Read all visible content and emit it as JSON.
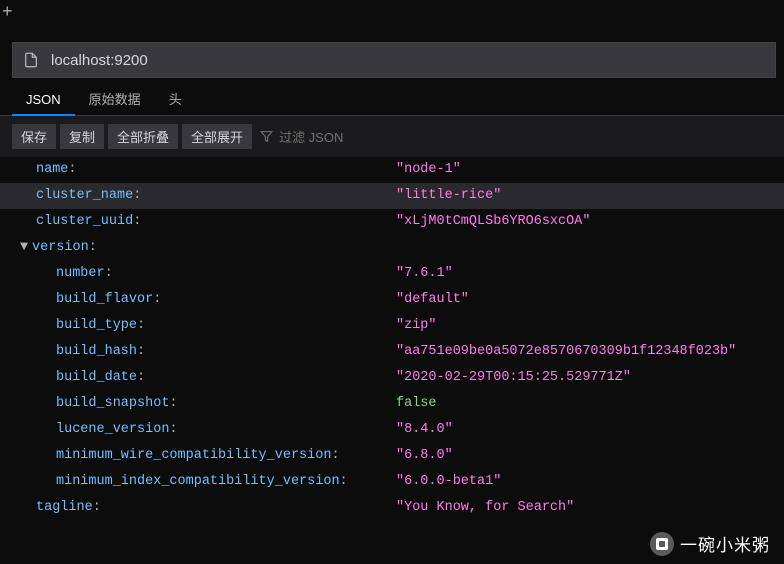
{
  "window": {
    "new_tab_icon": "+"
  },
  "address_bar": {
    "url": "localhost:9200"
  },
  "tabs": {
    "json": "JSON",
    "raw": "原始数据",
    "headers": "头"
  },
  "toolbar": {
    "save": "保存",
    "copy": "复制",
    "collapse_all": "全部折叠",
    "expand_all": "全部展开",
    "filter_placeholder": "过滤 JSON"
  },
  "json": {
    "name_key": "name",
    "name_val": "\"node-1\"",
    "cluster_name_key": "cluster_name",
    "cluster_name_val": "\"little-rice\"",
    "cluster_uuid_key": "cluster_uuid",
    "cluster_uuid_val": "\"xLjM0tCmQLSb6YRO6sxcOA\"",
    "version_key": "version",
    "number_key": "number",
    "number_val": "\"7.6.1\"",
    "build_flavor_key": "build_flavor",
    "build_flavor_val": "\"default\"",
    "build_type_key": "build_type",
    "build_type_val": "\"zip\"",
    "build_hash_key": "build_hash",
    "build_hash_val": "\"aa751e09be0a5072e8570670309b1f12348f023b\"",
    "build_date_key": "build_date",
    "build_date_val": "\"2020-02-29T00:15:25.529771Z\"",
    "build_snapshot_key": "build_snapshot",
    "build_snapshot_val": "false",
    "lucene_version_key": "lucene_version",
    "lucene_version_val": "\"8.4.0\"",
    "min_wire_key": "minimum_wire_compatibility_version",
    "min_wire_val": "\"6.8.0\"",
    "min_index_key": "minimum_index_compatibility_version",
    "min_index_val": "\"6.0.0-beta1\"",
    "tagline_key": "tagline",
    "tagline_val": "\"You Know, for Search\""
  },
  "watermark": {
    "text": "一碗小米粥"
  }
}
